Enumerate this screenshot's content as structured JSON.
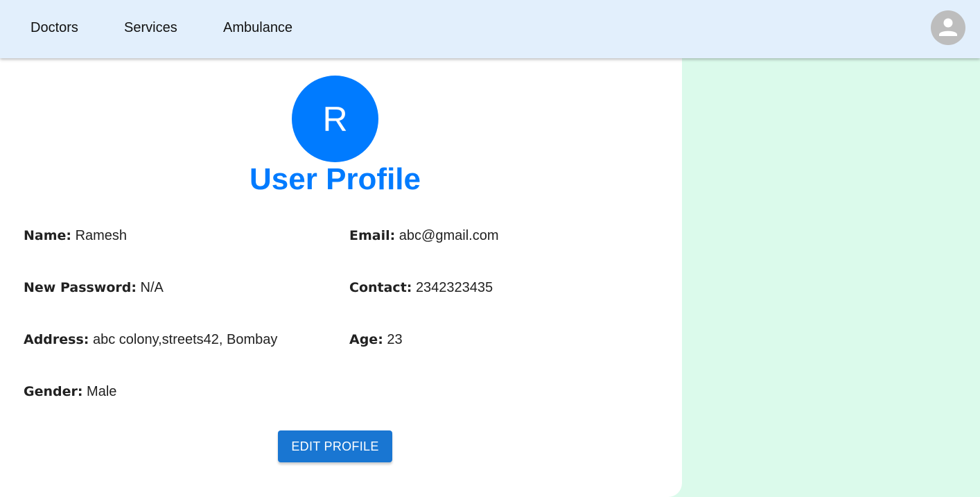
{
  "nav": {
    "items": [
      {
        "label": "Doctors"
      },
      {
        "label": "Services"
      },
      {
        "label": "Ambulance"
      }
    ],
    "account_icon": "account-circle-icon"
  },
  "profile": {
    "avatar_initial": "R",
    "title": "User Profile",
    "fields": {
      "name": {
        "label": "Name:",
        "value": "Ramesh"
      },
      "email": {
        "label": "Email:",
        "value": "abc@gmail.com"
      },
      "new_password": {
        "label": "New Password:",
        "value": "N/A"
      },
      "contact": {
        "label": "Contact:",
        "value": "2342323435"
      },
      "address": {
        "label": "Address:",
        "value": "abc colony,streets42, Bombay"
      },
      "age": {
        "label": "Age:",
        "value": "23"
      },
      "gender": {
        "label": "Gender:",
        "value": "Male"
      }
    },
    "edit_button_label": "EDIT PROFILE"
  },
  "colors": {
    "accent": "#007bff",
    "button": "#1976d2",
    "navbar": "#e2effc",
    "background": "#dbfaeb"
  }
}
